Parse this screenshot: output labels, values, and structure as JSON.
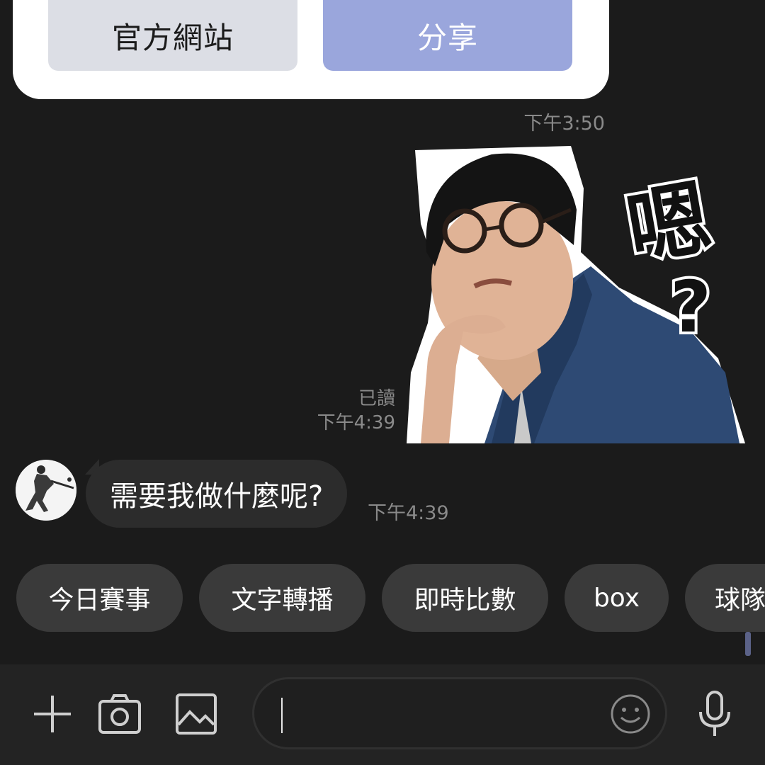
{
  "flex_card": {
    "official_site_label": "官方網站",
    "share_label": "分享"
  },
  "messages": {
    "card_time": "下午3:50",
    "sticker": {
      "read_status": "已讀",
      "time": "下午4:39",
      "text_glyph": "嗯",
      "question_mark": "?"
    },
    "incoming": {
      "text": "需要我做什麼呢?",
      "time": "下午4:39"
    }
  },
  "quick_replies": [
    "今日賽事",
    "文字轉播",
    "即時比數",
    "box",
    "球隊"
  ],
  "input_bar": {
    "icons": [
      "plus-icon",
      "camera-icon",
      "image-icon",
      "emoji-icon",
      "microphone-icon"
    ],
    "text_value": ""
  },
  "colors": {
    "background": "#1b1b1b",
    "share_button": "#9aa6dc",
    "official_button": "#dcdee5",
    "bubble": "#2c2c2c",
    "chip": "#3a3a3a"
  }
}
